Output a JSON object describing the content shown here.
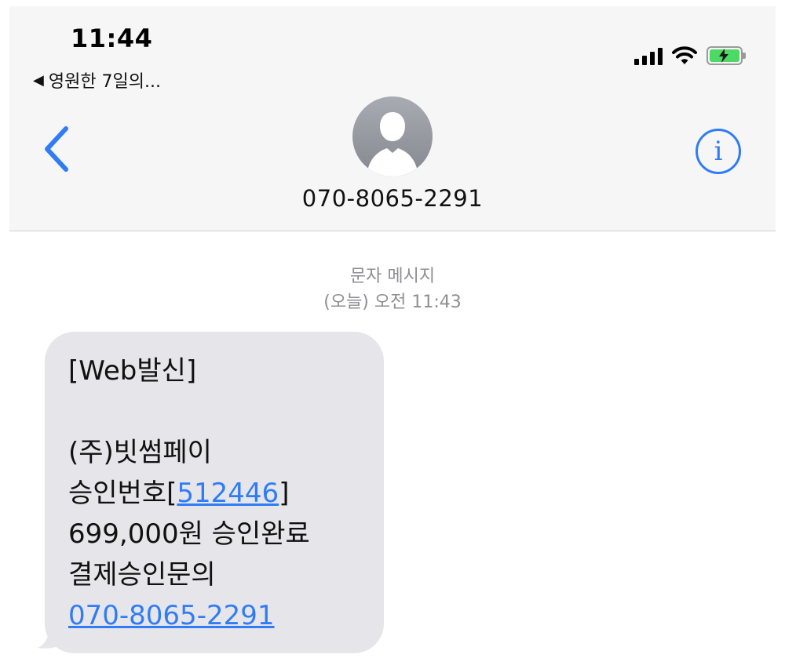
{
  "status_bar": {
    "time": "11:44",
    "back_app": "영원한 7일의..."
  },
  "header": {
    "contact_name": "070-8065-2291",
    "info_label": "i"
  },
  "meta": {
    "message_type": "문자 메시지",
    "timestamp": "(오늘) 오전 11:43"
  },
  "message": {
    "line1": "[Web발신]",
    "line2": "(주)빗썸페이",
    "line3_prefix": "승인번호[",
    "approval_code": "512446",
    "line3_suffix": "]",
    "line4": "699,000원 승인완료",
    "line5": "결제승인문의",
    "phone_link": "070-8065-2291"
  },
  "colors": {
    "accent": "#2f7cf6",
    "bubble": "#e5e5ea",
    "header_bg": "#f6f6f6",
    "battery": "#4cd964"
  },
  "icons": {
    "back": "chevron-left-icon",
    "info": "info-icon",
    "avatar": "person-silhouette-icon",
    "signal": "cellular-signal-icon",
    "wifi": "wifi-icon",
    "battery": "battery-charging-icon"
  }
}
